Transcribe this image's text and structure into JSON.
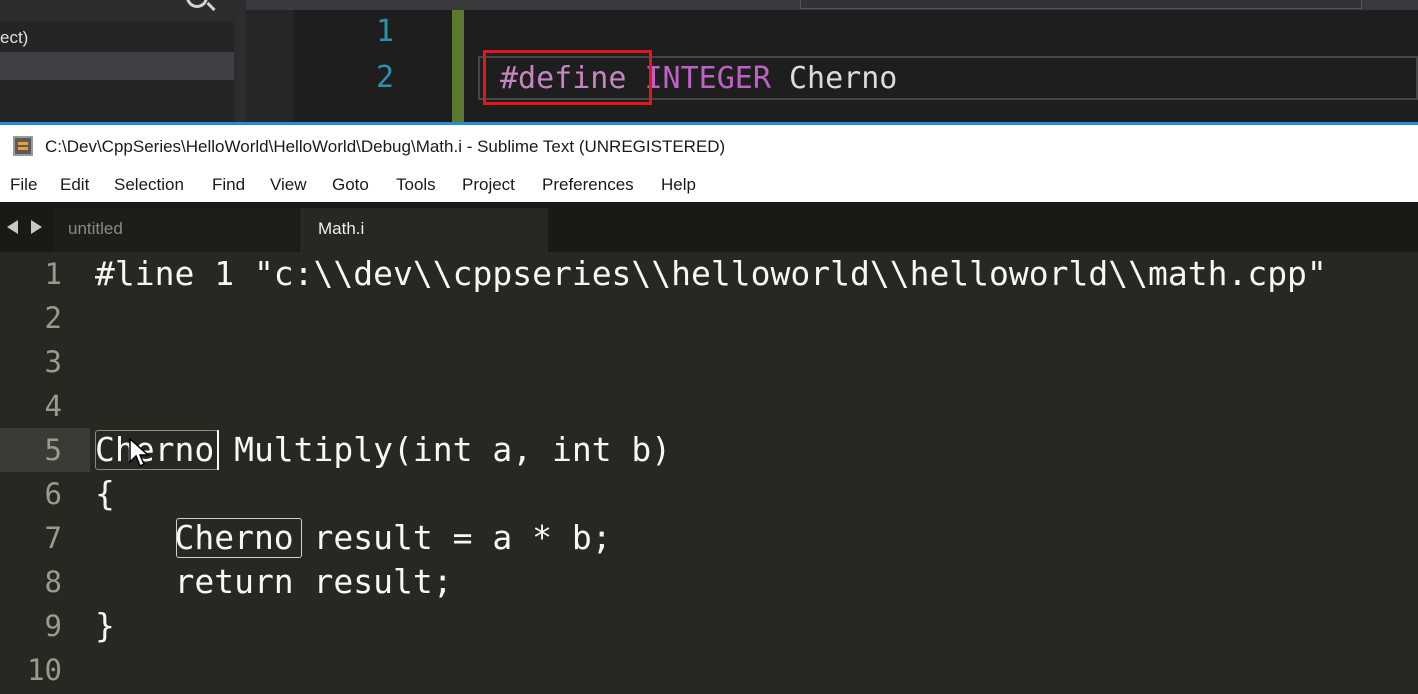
{
  "vs_background": {
    "tree_label": "ect)",
    "line_numbers": [
      "1",
      "2"
    ],
    "code_define": "#define",
    "code_integer": "INTEGER",
    "code_cherno": "Cherno"
  },
  "sublime": {
    "window_title": "C:\\Dev\\CppSeries\\HelloWorld\\HelloWorld\\Debug\\Math.i - Sublime Text (UNREGISTERED)",
    "menu": [
      "File",
      "Edit",
      "Selection",
      "Find",
      "View",
      "Goto",
      "Tools",
      "Project",
      "Preferences",
      "Help"
    ],
    "tabs": [
      {
        "label": "untitled",
        "active": false
      },
      {
        "label": "Math.i",
        "active": true
      }
    ],
    "lines": [
      {
        "num": "1",
        "code": "#line 1 \"c:\\\\dev\\\\cppseries\\\\helloworld\\\\helloworld\\\\math.cpp\""
      },
      {
        "num": "2",
        "code": ""
      },
      {
        "num": "3",
        "code": ""
      },
      {
        "num": "4",
        "code": ""
      },
      {
        "num": "5",
        "code": "Cherno Multiply(int a, int b)"
      },
      {
        "num": "6",
        "code": "{"
      },
      {
        "num": "7",
        "code": "    Cherno result = a * b;"
      },
      {
        "num": "8",
        "code": "    return result;"
      },
      {
        "num": "9",
        "code": "}"
      },
      {
        "num": "10",
        "code": ""
      }
    ]
  },
  "colors": {
    "highlight_box": "#e8141c",
    "define_keyword": "#c586c0",
    "sublime_background": "#272822"
  }
}
